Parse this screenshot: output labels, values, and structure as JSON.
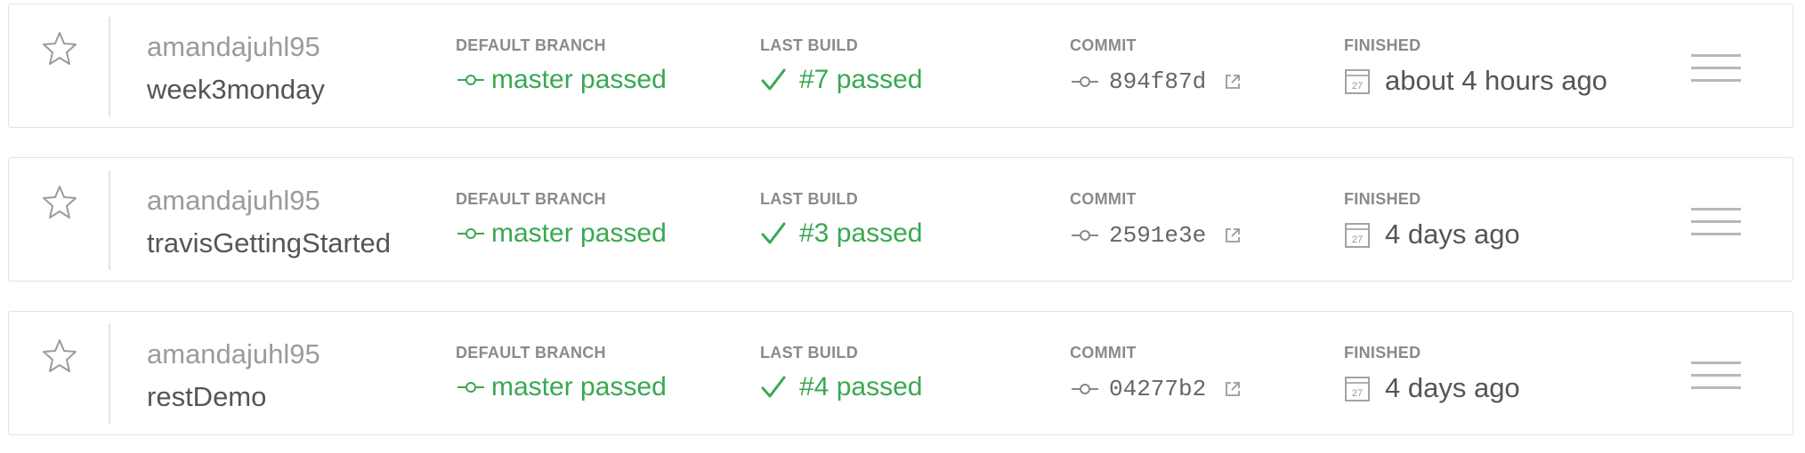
{
  "labels": {
    "default_branch": "DEFAULT BRANCH",
    "last_build": "LAST BUILD",
    "commit": "COMMIT",
    "finished": "FINISHED"
  },
  "calendar_day": "27",
  "colors": {
    "passed": "#39a852",
    "border": "#e3e3e3"
  },
  "icons": {
    "star": "star-outline-icon",
    "branch": "commit-node-icon",
    "build_status": "check-icon",
    "external": "external-link-icon",
    "finished": "calendar-icon",
    "menu": "hamburger-menu-icon"
  },
  "repos": [
    {
      "owner": "amandajuhl95",
      "name": "week3monday",
      "branch_status": "master passed",
      "build": "#7 passed",
      "commit": "894f87d",
      "finished": "about 4 hours ago"
    },
    {
      "owner": "amandajuhl95",
      "name": "travisGettingStarted",
      "branch_status": "master passed",
      "build": "#3 passed",
      "commit": "2591e3e",
      "finished": "4 days ago"
    },
    {
      "owner": "amandajuhl95",
      "name": "restDemo",
      "branch_status": "master passed",
      "build": "#4 passed",
      "commit": "04277b2",
      "finished": "4 days ago"
    }
  ]
}
